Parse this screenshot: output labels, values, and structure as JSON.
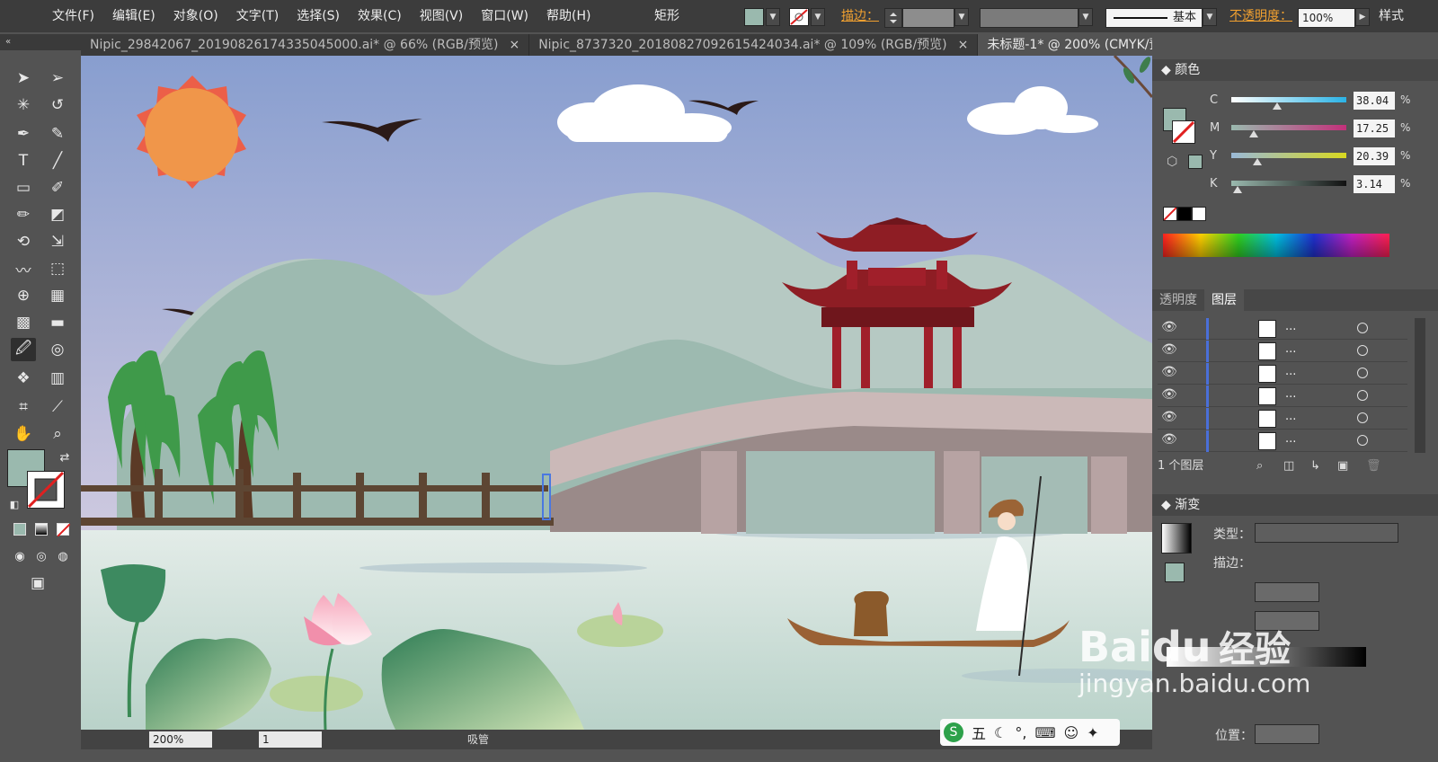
{
  "menu": [
    "文件(F)",
    "编辑(E)",
    "对象(O)",
    "文字(T)",
    "选择(S)",
    "效果(C)",
    "视图(V)",
    "窗口(W)",
    "帮助(H)"
  ],
  "control_bar": {
    "selection_type": "矩形",
    "stroke_label": "描边：",
    "brush": "基本",
    "opacity_label": "不透明度：",
    "opacity_value": "100%",
    "style_label": "样式"
  },
  "tabs": [
    {
      "label": "Nipic_29842067_20190826174335045000.ai* @ 66% (RGB/预览)",
      "close": "×"
    },
    {
      "label": "Nipic_8737320_20180827092615424034.ai* @ 109% (RGB/预览)",
      "close": "×"
    },
    {
      "label": "未标题-1* @ 200% (CMYK/预览)",
      "close": ""
    }
  ],
  "colors": {
    "fill": "#9ab9ae",
    "sky_top": "#8a9fcf",
    "sky_bottom": "#e9dde6",
    "mountain": "#9dbab0",
    "water": "#c8dcd6",
    "pavilion": "#8e1d24",
    "bridge": "#cbb9b8",
    "accent_orange": "#f0a030"
  },
  "color_panel": {
    "title": "颜色",
    "channels": [
      {
        "label": "C",
        "value": "38.04",
        "unit": "%"
      },
      {
        "label": "M",
        "value": "17.25",
        "unit": "%"
      },
      {
        "label": "Y",
        "value": "20.39",
        "unit": "%"
      },
      {
        "label": "K",
        "value": "3.14",
        "unit": "%"
      }
    ]
  },
  "layers_panel": {
    "tabs": [
      "透明度",
      "图层"
    ],
    "rows": [
      "...",
      "...",
      "...",
      "...",
      "...",
      "..."
    ],
    "footer": "1 个图层"
  },
  "gradient_panel": {
    "title": "渐变",
    "type_label": "类型：",
    "stroke_label": "描边：",
    "position_label": "位置："
  },
  "status": {
    "zoom": "200%",
    "page": "1",
    "tool": "吸管"
  },
  "watermark": {
    "brand": "Bai",
    "paw": "du",
    "jingyan": "经验",
    "url": "jingyan.baidu.com"
  },
  "ime": [
    "五",
    "⌨"
  ],
  "tool_icons": [
    "selection-icon",
    "direct-selection-icon",
    "magic-wand-icon",
    "lasso-icon",
    "pen-icon",
    "curvature-icon",
    "type-icon",
    "line-icon",
    "rectangle-icon",
    "paintbrush-icon",
    "pencil-icon",
    "eraser-icon",
    "rotate-icon",
    "scale-icon",
    "warp-icon",
    "free-transform-icon",
    "shape-builder-icon",
    "perspective-grid-icon",
    "mesh-icon",
    "gradient-icon",
    "eyedropper-icon",
    "blend-icon",
    "symbol-sprayer-icon",
    "column-graph-icon",
    "artboard-icon",
    "slice-icon",
    "hand-icon",
    "zoom-icon"
  ]
}
